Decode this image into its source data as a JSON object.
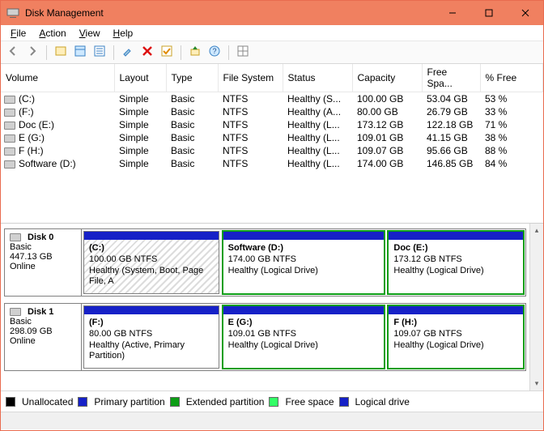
{
  "window": {
    "title": "Disk Management"
  },
  "menu": {
    "file": "File",
    "action": "Action",
    "view": "View",
    "help": "Help"
  },
  "columns": {
    "volume": "Volume",
    "layout": "Layout",
    "type": "Type",
    "fs": "File System",
    "status": "Status",
    "capacity": "Capacity",
    "free": "Free Spa...",
    "pct": "% Free"
  },
  "volumes": [
    {
      "name": "(C:)",
      "layout": "Simple",
      "type": "Basic",
      "fs": "NTFS",
      "status": "Healthy (S...",
      "capacity": "100.00 GB",
      "free": "53.04 GB",
      "pct": "53 %"
    },
    {
      "name": "(F:)",
      "layout": "Simple",
      "type": "Basic",
      "fs": "NTFS",
      "status": "Healthy (A...",
      "capacity": "80.00 GB",
      "free": "26.79 GB",
      "pct": "33 %"
    },
    {
      "name": "Doc (E:)",
      "layout": "Simple",
      "type": "Basic",
      "fs": "NTFS",
      "status": "Healthy (L...",
      "capacity": "173.12 GB",
      "free": "122.18 GB",
      "pct": "71 %"
    },
    {
      "name": "E (G:)",
      "layout": "Simple",
      "type": "Basic",
      "fs": "NTFS",
      "status": "Healthy (L...",
      "capacity": "109.01 GB",
      "free": "41.15 GB",
      "pct": "38 %"
    },
    {
      "name": "F (H:)",
      "layout": "Simple",
      "type": "Basic",
      "fs": "NTFS",
      "status": "Healthy (L...",
      "capacity": "109.07 GB",
      "free": "95.66 GB",
      "pct": "88 %"
    },
    {
      "name": "Software (D:)",
      "layout": "Simple",
      "type": "Basic",
      "fs": "NTFS",
      "status": "Healthy (L...",
      "capacity": "174.00 GB",
      "free": "146.85 GB",
      "pct": "84 %"
    }
  ],
  "disks": [
    {
      "label": "Disk 0",
      "type": "Basic",
      "size": "447.13 GB",
      "state": "Online",
      "parts": [
        {
          "title": "(C:)",
          "line2": "100.00 GB NTFS",
          "line3": "Healthy (System, Boot, Page File, A",
          "green": false,
          "hatched": true,
          "flex": 1
        },
        {
          "title": "Software  (D:)",
          "line2": "174.00 GB NTFS",
          "line3": "Healthy (Logical Drive)",
          "green": true,
          "hatched": false,
          "flex": 1.2
        },
        {
          "title": "Doc  (E:)",
          "line2": "173.12 GB NTFS",
          "line3": "Healthy (Logical Drive)",
          "green": true,
          "hatched": false,
          "flex": 1
        }
      ]
    },
    {
      "label": "Disk 1",
      "type": "Basic",
      "size": "298.09 GB",
      "state": "Online",
      "parts": [
        {
          "title": "(F:)",
          "line2": "80.00 GB NTFS",
          "line3": "Healthy (Active, Primary Partition)",
          "green": false,
          "hatched": false,
          "flex": 1
        },
        {
          "title": "E  (G:)",
          "line2": "109.01 GB NTFS",
          "line3": "Healthy (Logical Drive)",
          "green": true,
          "hatched": false,
          "flex": 1.2
        },
        {
          "title": "F  (H:)",
          "line2": "109.07 GB NTFS",
          "line3": "Healthy (Logical Drive)",
          "green": true,
          "hatched": false,
          "flex": 1
        }
      ]
    }
  ],
  "legend": {
    "unallocated": "Unallocated",
    "primary": "Primary partition",
    "extended": "Extended partition",
    "free": "Free space",
    "logical": "Logical drive"
  },
  "toolbar_icons": {
    "back": "back-icon",
    "forward": "forward-icon",
    "refresh": "refresh-icon",
    "props": "properties-icon",
    "list": "list-icon",
    "delete": "delete-icon",
    "check": "check-icon",
    "up": "up-icon",
    "help": "help-icon",
    "grid": "grid-icon",
    "view": "view-icon"
  }
}
